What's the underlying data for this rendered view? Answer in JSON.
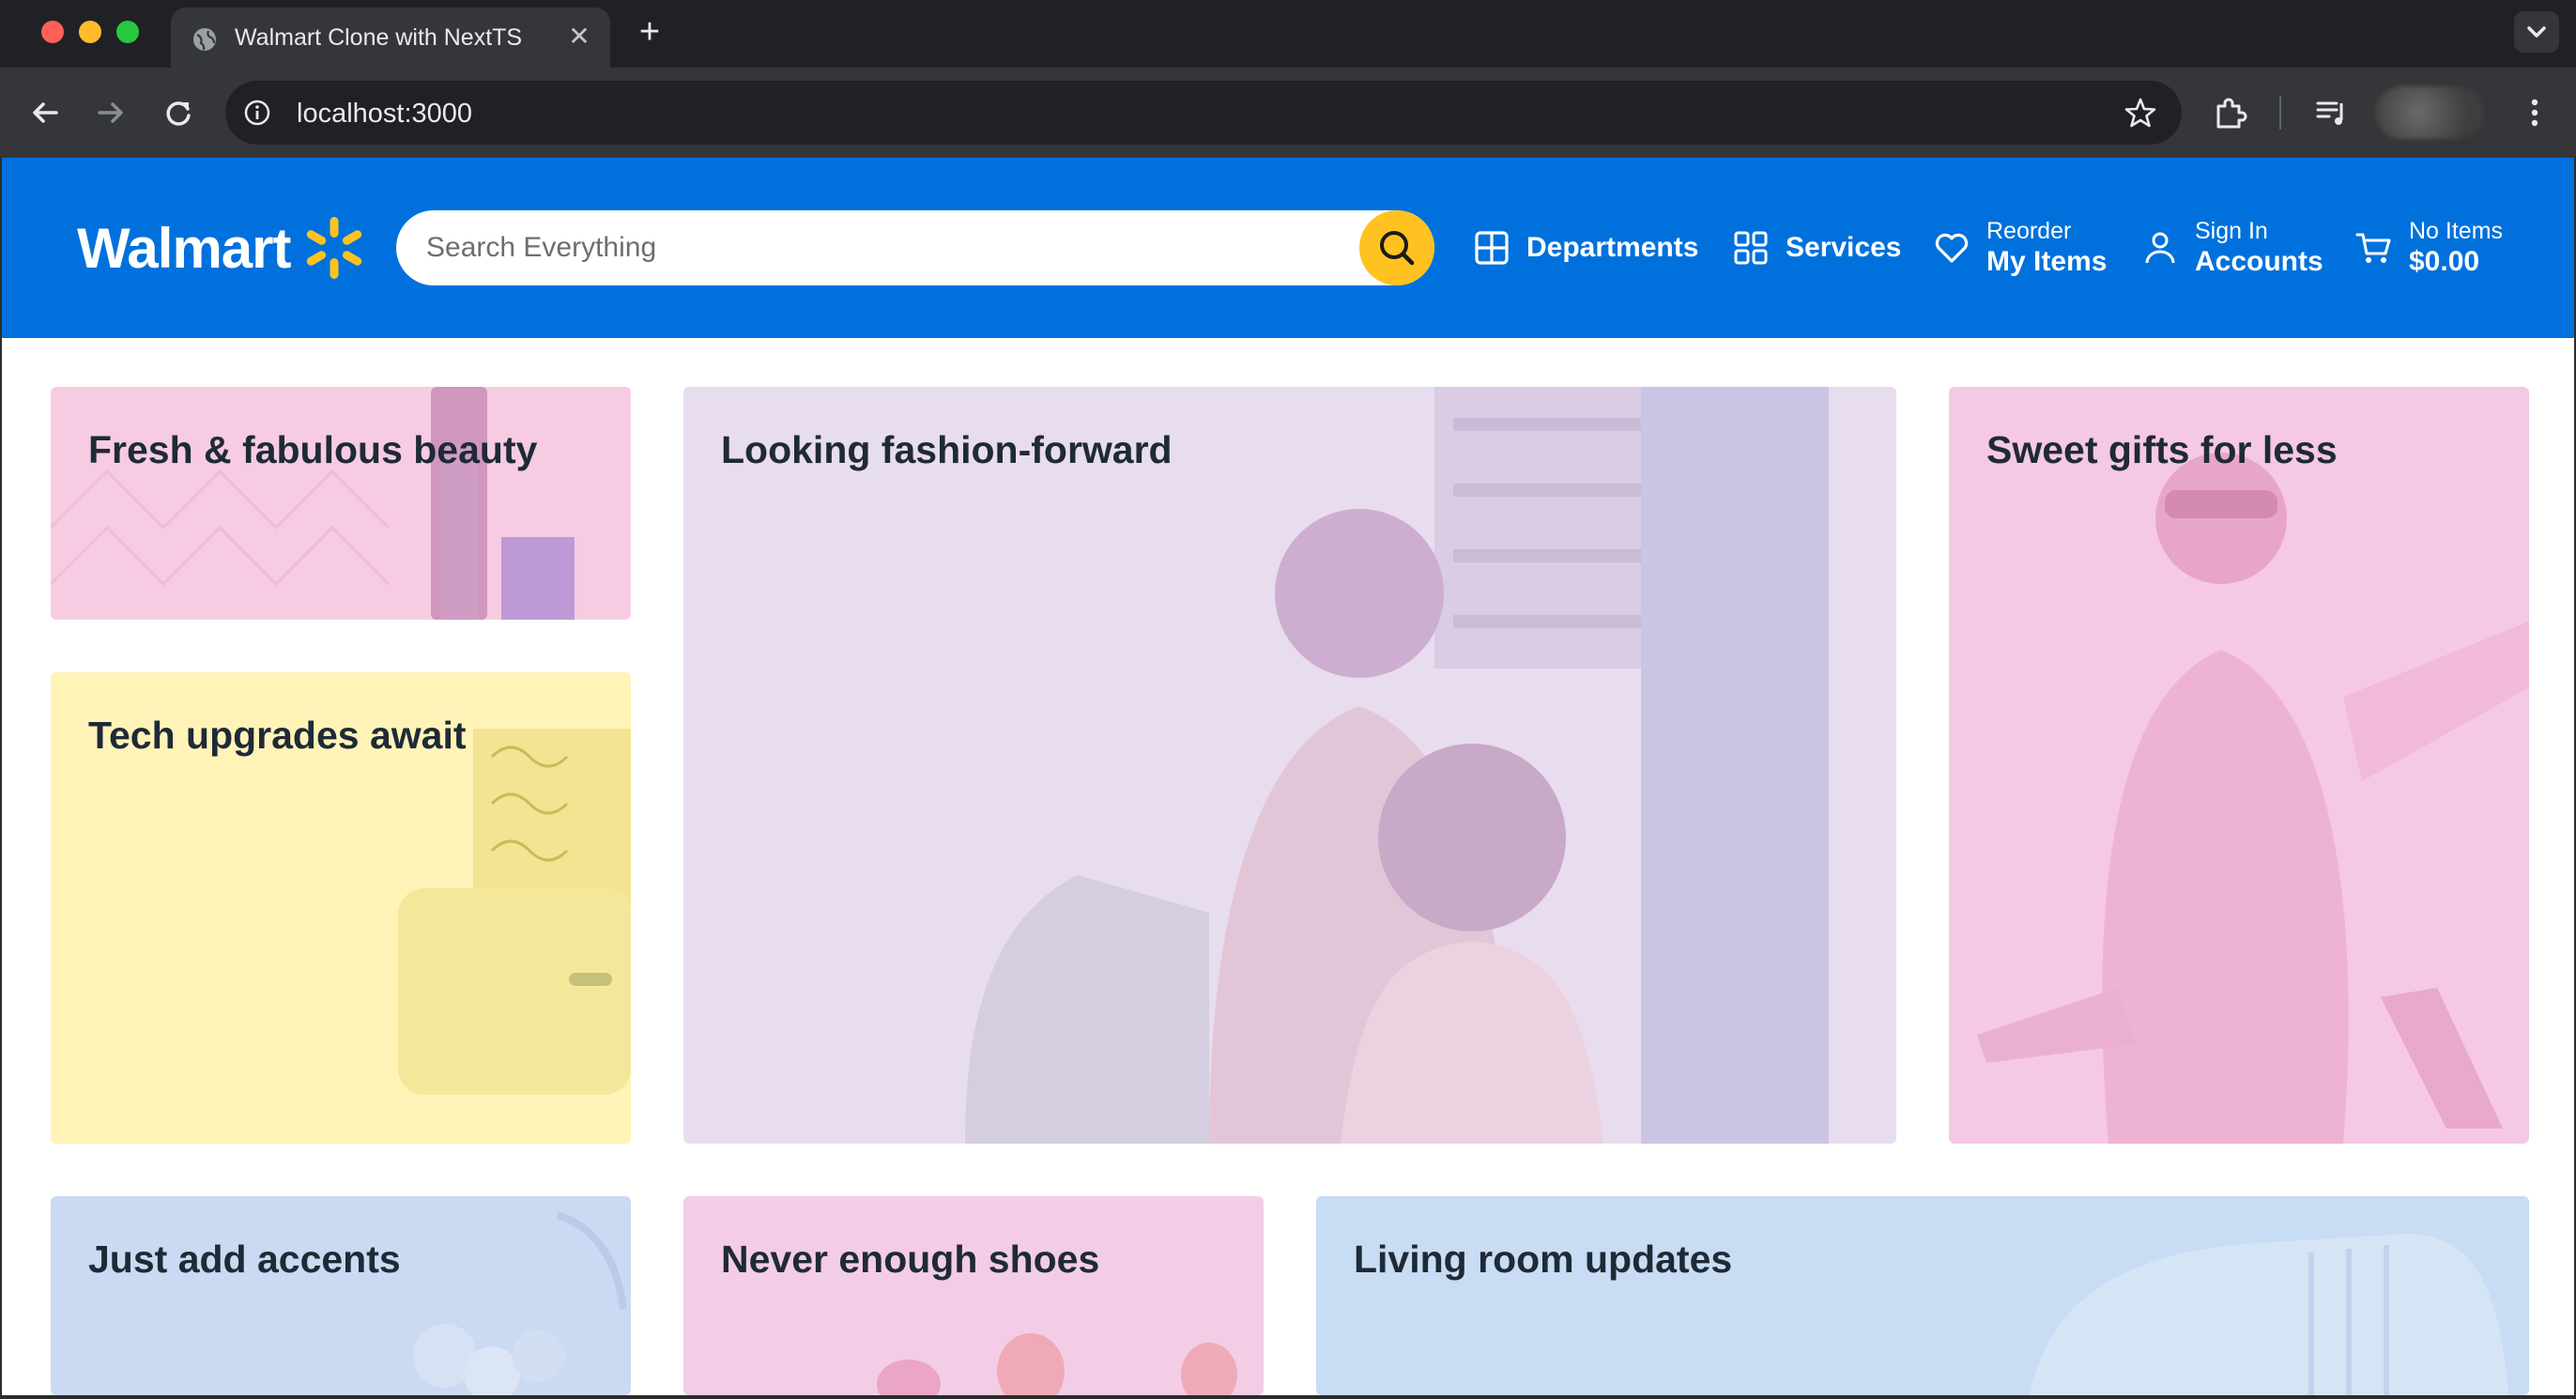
{
  "browser": {
    "tab_title": "Walmart Clone with NextTS",
    "tab_close": "✕",
    "new_tab": "+",
    "url": "localhost:3000"
  },
  "header": {
    "logo_text": "Walmart",
    "search_placeholder": "Search Everything",
    "departments_label": "Departments",
    "services_label": "Services",
    "reorder_small": "Reorder",
    "reorder_big": "My Items",
    "signin_small": "Sign In",
    "signin_big": "Accounts",
    "cart_small": "No Items",
    "cart_big": "$0.00",
    "colors": {
      "brand_blue": "#0071dc",
      "spark_yellow": "#ffc220"
    }
  },
  "cards": {
    "beauty": "Fresh & fabulous beauty",
    "fashion": "Looking fashion-forward",
    "gifts": "Sweet gifts for less",
    "tech": "Tech upgrades await",
    "accents": "Just add accents",
    "shoes": "Never enough shoes",
    "living": "Living room updates"
  }
}
